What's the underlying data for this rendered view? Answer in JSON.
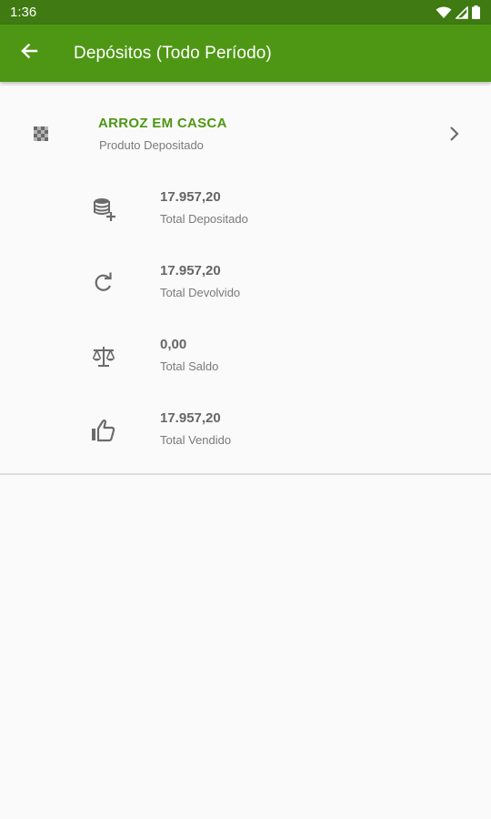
{
  "status_bar": {
    "time": "1:36",
    "icons": [
      "wifi-icon",
      "signal-icon",
      "battery-icon"
    ]
  },
  "app_bar": {
    "back_icon": "arrow-left-icon",
    "title": "Depósitos (Todo Período)",
    "color": "#4e9714",
    "status_color": "#3f7a12"
  },
  "product": {
    "icon": "grain-icon",
    "name": "ARROZ EM CASCA",
    "subtitle": "Produto Depositado",
    "chevron_icon": "chevron-right-icon",
    "name_color": "#4e9714"
  },
  "stats": [
    {
      "icon": "database-add-icon",
      "value": "17.957,20",
      "label": "Total Depositado"
    },
    {
      "icon": "refresh-icon",
      "value": "17.957,20",
      "label": "Total Devolvido"
    },
    {
      "icon": "scale-icon",
      "value": "0,00",
      "label": "Total Saldo"
    },
    {
      "icon": "thumbs-up-icon",
      "value": "17.957,20",
      "label": "Total Vendido"
    }
  ]
}
